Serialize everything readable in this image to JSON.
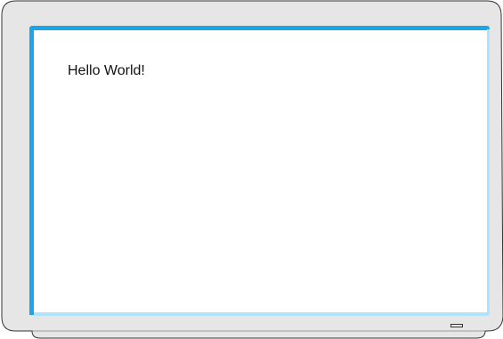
{
  "screen": {
    "text": "Hello World!"
  },
  "colors": {
    "bezel": "#e6e6e6",
    "bezel_outline": "#333333",
    "screen_edge": "#1aa7ea",
    "screen_edge_light": "#aee3fb",
    "screen_background": "#ffffff"
  },
  "icons": {
    "power_indicator": "power-led-icon"
  }
}
